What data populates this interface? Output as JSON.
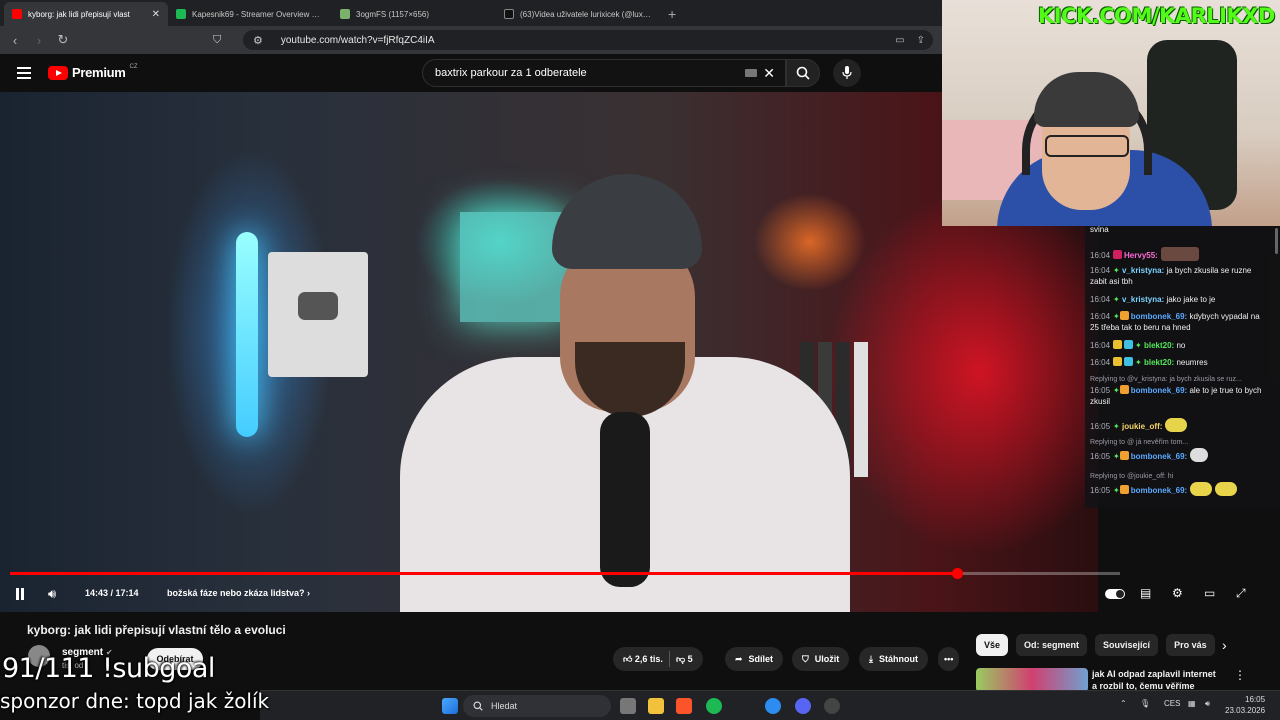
{
  "browser": {
    "tabs": [
      {
        "title": "kyborg: jak lidi přepisují vlast",
        "active": true,
        "fav_color": "#ff0000"
      },
      {
        "title": "Kapesnik69 - Streamer Overview & S",
        "active": false,
        "fav_color": "#1db954"
      },
      {
        "title": "3ogmFS (1157×656)",
        "active": false,
        "fav_color": "#7bb26b"
      },
      {
        "title": "(63)Videa uživatele lurixicek (@luxixic",
        "active": false,
        "fav_color": "#111111"
      }
    ],
    "new_tab": "+",
    "url": "youtube.com/watch?v=fjRfqZC4iIA"
  },
  "youtube": {
    "logo_text": "Premium",
    "logo_country": "CZ",
    "search_value": "baxtrix parkour za 1 odberatele",
    "player": {
      "time": "14:43 / 17:14",
      "chapter": "božská fáze nebo zkáza lidstva?",
      "progress": 0.8536
    },
    "video_title": "kyborg: jak lidi přepisují vlastní tělo a evoluci",
    "channel": {
      "name": "segment",
      "verified": "✔",
      "subs": "tis. od",
      "subscribe_label": "Odebírat"
    },
    "actions": {
      "likes": "2,6 tis.",
      "dislikes": "5",
      "share": "Sdílet",
      "save": "Uložit",
      "download": "Stáhnout",
      "more": "•••"
    },
    "chips": [
      "Vše",
      "Od: segment",
      "Související",
      "Pro vás"
    ],
    "recommended": {
      "title": "jak AI odpad zaplavil internet a rozbil to, čemu věříme"
    }
  },
  "stream": {
    "kick_url": "KICK.COM/KARLIKXD",
    "subgoal": "91/111 !subgoal",
    "sponsor": "sponzor dne: topd jak žolík"
  },
  "chat": {
    "top_fragment": "svina",
    "messages": [
      {
        "time": "16:04",
        "user": "Hervy55:",
        "color": "#ff6bd6",
        "text": "",
        "emote": true
      },
      {
        "time": "16:04",
        "user": "v_kristyna:",
        "color": "#7ad3ff",
        "text": "ja bych zkusila se ruzne zabit asi tbh"
      },
      {
        "time": "16:04",
        "user": "v_kristyna:",
        "color": "#7ad3ff",
        "text": "jako jake to je"
      },
      {
        "time": "16:04",
        "user": "bombonek_69:",
        "color": "#5aa9ff",
        "text": "kdybych vypadal na 25 třeba tak to beru na hned"
      },
      {
        "time": "16:04",
        "user": "blekt20:",
        "color": "#54e85a",
        "text": "no"
      },
      {
        "time": "16:04",
        "user": "blekt20:",
        "color": "#54e85a",
        "text": "neumres"
      },
      {
        "time": "16:05",
        "user": "bombonek_69:",
        "color": "#5aa9ff",
        "text": "ale to je true to bych zkusil",
        "reply": "Replying to @v_kristyna: ja bych zkusila se ruz..."
      },
      {
        "time": "16:05",
        "user": "joukie_off:",
        "color": "#f5d66a",
        "text": "",
        "emote": true
      },
      {
        "time": "16:05",
        "user": "bombonek_69:",
        "color": "#5aa9ff",
        "text": "",
        "emote": true,
        "reply": "Replying to @ já nevěřím tom..."
      },
      {
        "time": "16:05",
        "user": "bombonek_69:",
        "color": "#5aa9ff",
        "text": "",
        "emote": true,
        "reply": "Replying to @joukie_off: hi"
      }
    ]
  },
  "taskbar": {
    "search_placeholder": "Hledat",
    "lang": "CES",
    "time": "16:05",
    "date": "23.03.2026"
  }
}
